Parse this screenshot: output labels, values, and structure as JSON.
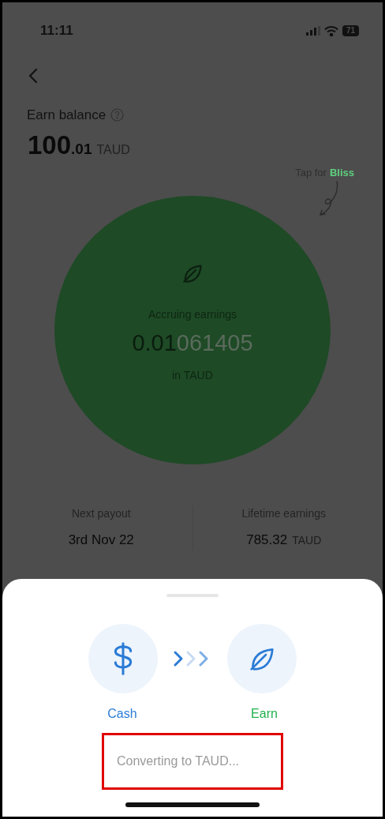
{
  "status_bar": {
    "time": "11:11",
    "battery": "71"
  },
  "balance": {
    "label": "Earn balance",
    "whole": "100",
    "fraction": ".01",
    "currency": "TAUD"
  },
  "hint": {
    "text": "Tap for",
    "link": "Bliss"
  },
  "accruing": {
    "label": "Accruing earnings",
    "value_main": "0.01",
    "value_tail": "061405",
    "unit": "in TAUD"
  },
  "stats": [
    {
      "label": "Next payout",
      "value": "3rd Nov 22"
    },
    {
      "label": "Lifetime earnings",
      "value": "785.32",
      "unit": "TAUD"
    }
  ],
  "sheet": {
    "from": {
      "label": "Cash",
      "kind": "cash"
    },
    "to": {
      "label": "Earn",
      "kind": "earn"
    },
    "status": {
      "text": "Converting to TAUD...",
      "highlighted": true
    }
  }
}
